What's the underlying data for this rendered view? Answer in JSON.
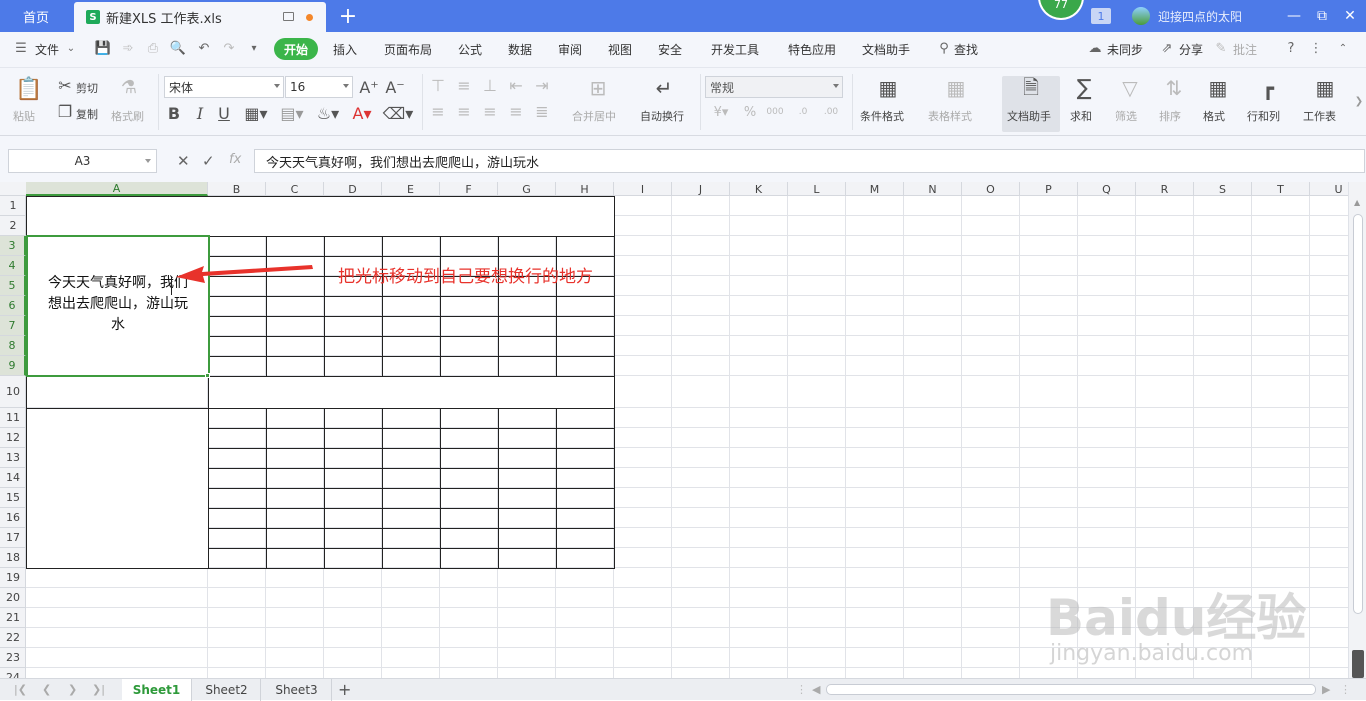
{
  "titlebar": {
    "home_tab": "首页",
    "doc_tab": "新建XLS 工作表.xls",
    "xls_icon_letter": "S",
    "badge_count": "77",
    "window_count": "1",
    "user_name": "迎接四点的太阳",
    "new_tab": "+"
  },
  "menu": {
    "file": "文件",
    "start": "开始",
    "items": [
      "插入",
      "页面布局",
      "公式",
      "数据",
      "审阅",
      "视图",
      "安全",
      "开发工具",
      "特色应用",
      "文档助手"
    ],
    "search": "查找",
    "sync": "未同步",
    "share": "分享",
    "comment": "批注"
  },
  "ribbon": {
    "paste": "粘贴",
    "cut": "剪切",
    "copy": "复制",
    "format_painter": "格式刷",
    "font_name": "宋体",
    "font_size": "16",
    "merge_center": "合并居中",
    "auto_wrap": "自动换行",
    "number_format": "常规",
    "conditional_format": "条件格式",
    "table_style": "表格样式",
    "doc_helper": "文档助手",
    "sum": "求和",
    "filter": "筛选",
    "sort": "排序",
    "format": "格式",
    "rows_cols": "行和列",
    "worksheet": "工作表"
  },
  "formula_bar": {
    "cell_ref": "A3",
    "fx": "fx",
    "content": "今天天气真好啊，我们想出去爬爬山，游山玩水"
  },
  "grid": {
    "columns": [
      "A",
      "B",
      "C",
      "D",
      "E",
      "F",
      "G",
      "H",
      "I",
      "J",
      "K",
      "L",
      "M",
      "N",
      "O",
      "P",
      "Q",
      "R",
      "S",
      "T",
      "U"
    ],
    "rows": [
      "1",
      "2",
      "3",
      "4",
      "5",
      "6",
      "7",
      "8",
      "9",
      "10",
      "11",
      "12",
      "13",
      "14",
      "15",
      "16",
      "17",
      "18",
      "19",
      "20",
      "21",
      "22",
      "23",
      "24"
    ],
    "selected_column": "A",
    "cell_a3_lines": [
      "今天天气真好啊，我们",
      "想出去爬爬山，游山玩",
      "水"
    ],
    "annotation": "把光标移动到自己要想换行的地方",
    "colors": {
      "selection": "#3e9b3e",
      "annotation": "#e8322b",
      "accent": "#4d7ae8"
    }
  },
  "sheets": {
    "tabs": [
      "Sheet1",
      "Sheet2",
      "Sheet3"
    ],
    "active": "Sheet1",
    "add": "+"
  },
  "watermark": {
    "brand": "Baidu经验",
    "url": "jingyan.baidu.com"
  }
}
